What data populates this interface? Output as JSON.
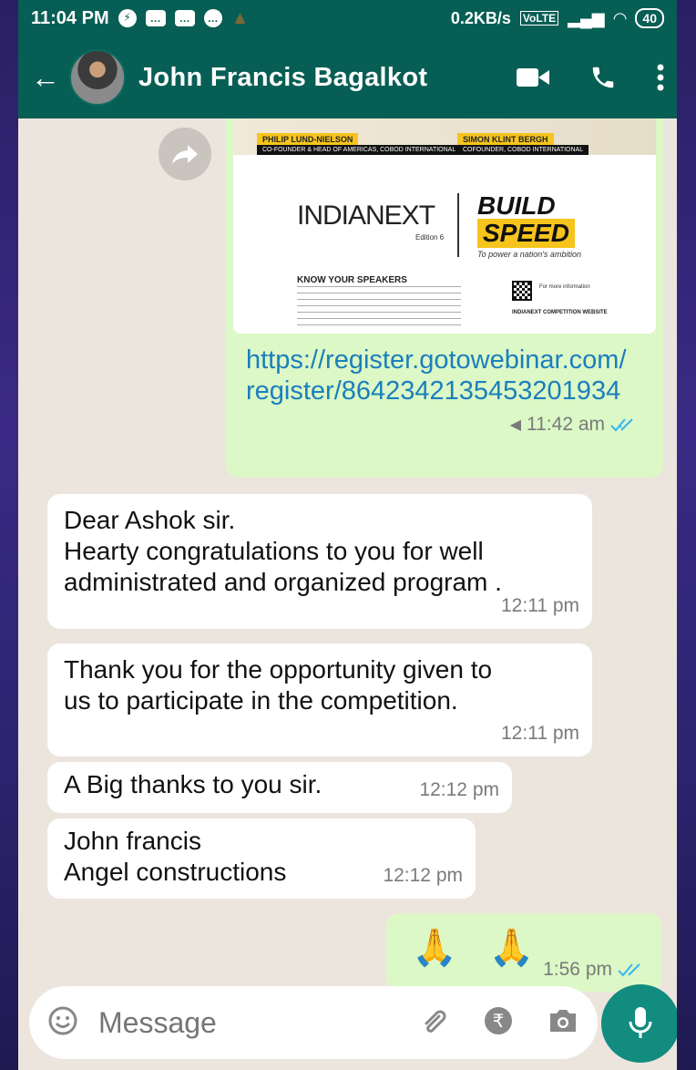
{
  "status_bar": {
    "time": "11:04 PM",
    "net_speed": "0.2KB/s",
    "battery": "40"
  },
  "header": {
    "contact_name": "John Francis Bagalkot"
  },
  "poster": {
    "speaker1_name": "PHILIP LUND-NIELSON",
    "speaker1_role": "CO-FOUNDER & HEAD OF AMERICAS, COBOD INTERNATIONAL",
    "speaker2_name": "SIMON KLINT BERGH",
    "speaker2_role": "COFOUNDER, COBOD INTERNATIONAL",
    "brand": "INDIANEXT",
    "edition": "Edition 6",
    "build": "BUILD",
    "speed": "SPEED",
    "tagline": "To power a nation's ambition",
    "know_title": "KNOW YOUR SPEAKERS",
    "qr_text": "For more information",
    "website_label": "INDIANEXT COMPETITION WEBSITE"
  },
  "messages": {
    "link": {
      "url": "https://register.gotowebinar.com/register/8642342135453201934",
      "time": "11:42 am"
    },
    "m1": {
      "text": "Dear Ashok sir.\nHearty congratulations to you for well administrated and organized program .",
      "time": "12:11 pm"
    },
    "m2": {
      "text": "Thank you for the opportunity given to us to participate in the competition.",
      "time": "12:11 pm"
    },
    "m3": {
      "text": "A Big thanks to you sir.",
      "time": "12:12 pm"
    },
    "m4": {
      "text": "John francis\nAngel constructions",
      "time": "12:12 pm"
    },
    "m5": {
      "text": "🙏 🙏",
      "time": "1:56 pm"
    }
  },
  "input": {
    "placeholder": "Message"
  },
  "icons": {
    "back": "back-arrow-icon",
    "video": "video-call-icon",
    "call": "phone-call-icon",
    "menu": "more-vert-icon",
    "forward": "forward-icon",
    "emoji": "emoji-icon",
    "attach": "paperclip-icon",
    "payment": "rupee-icon",
    "camera": "camera-icon",
    "mic": "mic-icon"
  },
  "colors": {
    "header": "#075e54",
    "chat_bg": "#ece5dd",
    "outgoing": "#dcf8c6",
    "incoming": "#ffffff",
    "accent": "#128c7e",
    "link": "#1a7fbd",
    "read_ticks": "#34b7f1"
  }
}
